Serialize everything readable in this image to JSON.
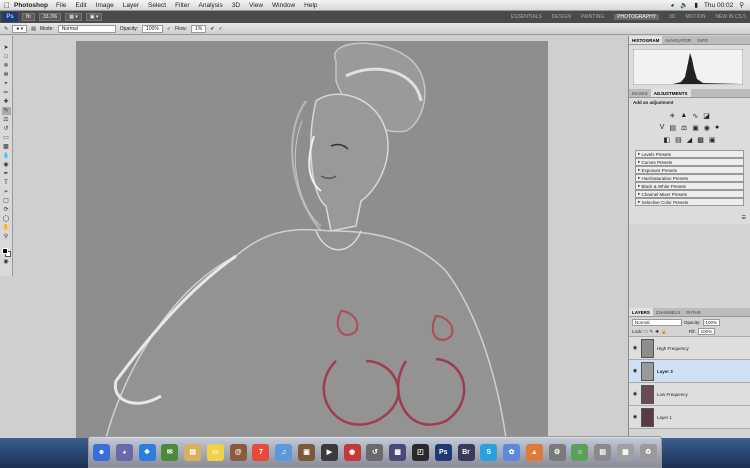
{
  "menubar": {
    "app": "Photoshop",
    "menus": [
      "File",
      "Edit",
      "Image",
      "Layer",
      "Select",
      "Filter",
      "Analysis",
      "3D",
      "View",
      "Window",
      "Help"
    ],
    "clock": "Thu 00:02"
  },
  "appbar": {
    "zoom": "33.3%",
    "workspaces": [
      "ESSENTIALS",
      "DESIGN",
      "PAINTING",
      "PHOTOGRAPHY",
      "3D",
      "MOTION",
      "NEW IN CS 5"
    ],
    "active_workspace": "PHOTOGRAPHY"
  },
  "options": {
    "mode_label": "Mode:",
    "mode_value": "Normal",
    "opacity_label": "Opacity:",
    "opacity_value": "100%",
    "flow_label": "Flow:",
    "flow_value": "1%"
  },
  "histogram_panel": {
    "tabs": [
      "HISTOGRAM",
      "NAVIGATOR",
      "INFO"
    ]
  },
  "adjustments_panel": {
    "tabs": [
      "MASKS",
      "ADJUSTMENTS"
    ],
    "heading": "Add an adjustment",
    "presets": [
      "Levels Presets",
      "Curves Presets",
      "Exposure Presets",
      "Hue/Saturation Presets",
      "Black & White Presets",
      "Channel Mixer Presets",
      "Selective Color Presets"
    ]
  },
  "layers_panel": {
    "tabs": [
      "LAYERS",
      "CHANNELS",
      "PATHS"
    ],
    "blend": "Normal",
    "opacity_label": "Opacity:",
    "opacity_value": "100%",
    "lock_label": "Lock:",
    "fill_label": "Fill:",
    "fill_value": "100%",
    "layers": [
      {
        "name": "High Frequency",
        "selected": false
      },
      {
        "name": "Layer 3",
        "selected": true
      },
      {
        "name": "Low Frequency",
        "selected": false
      },
      {
        "name": "Layer 1",
        "selected": false
      }
    ]
  },
  "colors": {
    "canvas": "#8e8e8e",
    "selected_layer": "#cfe0f5"
  }
}
